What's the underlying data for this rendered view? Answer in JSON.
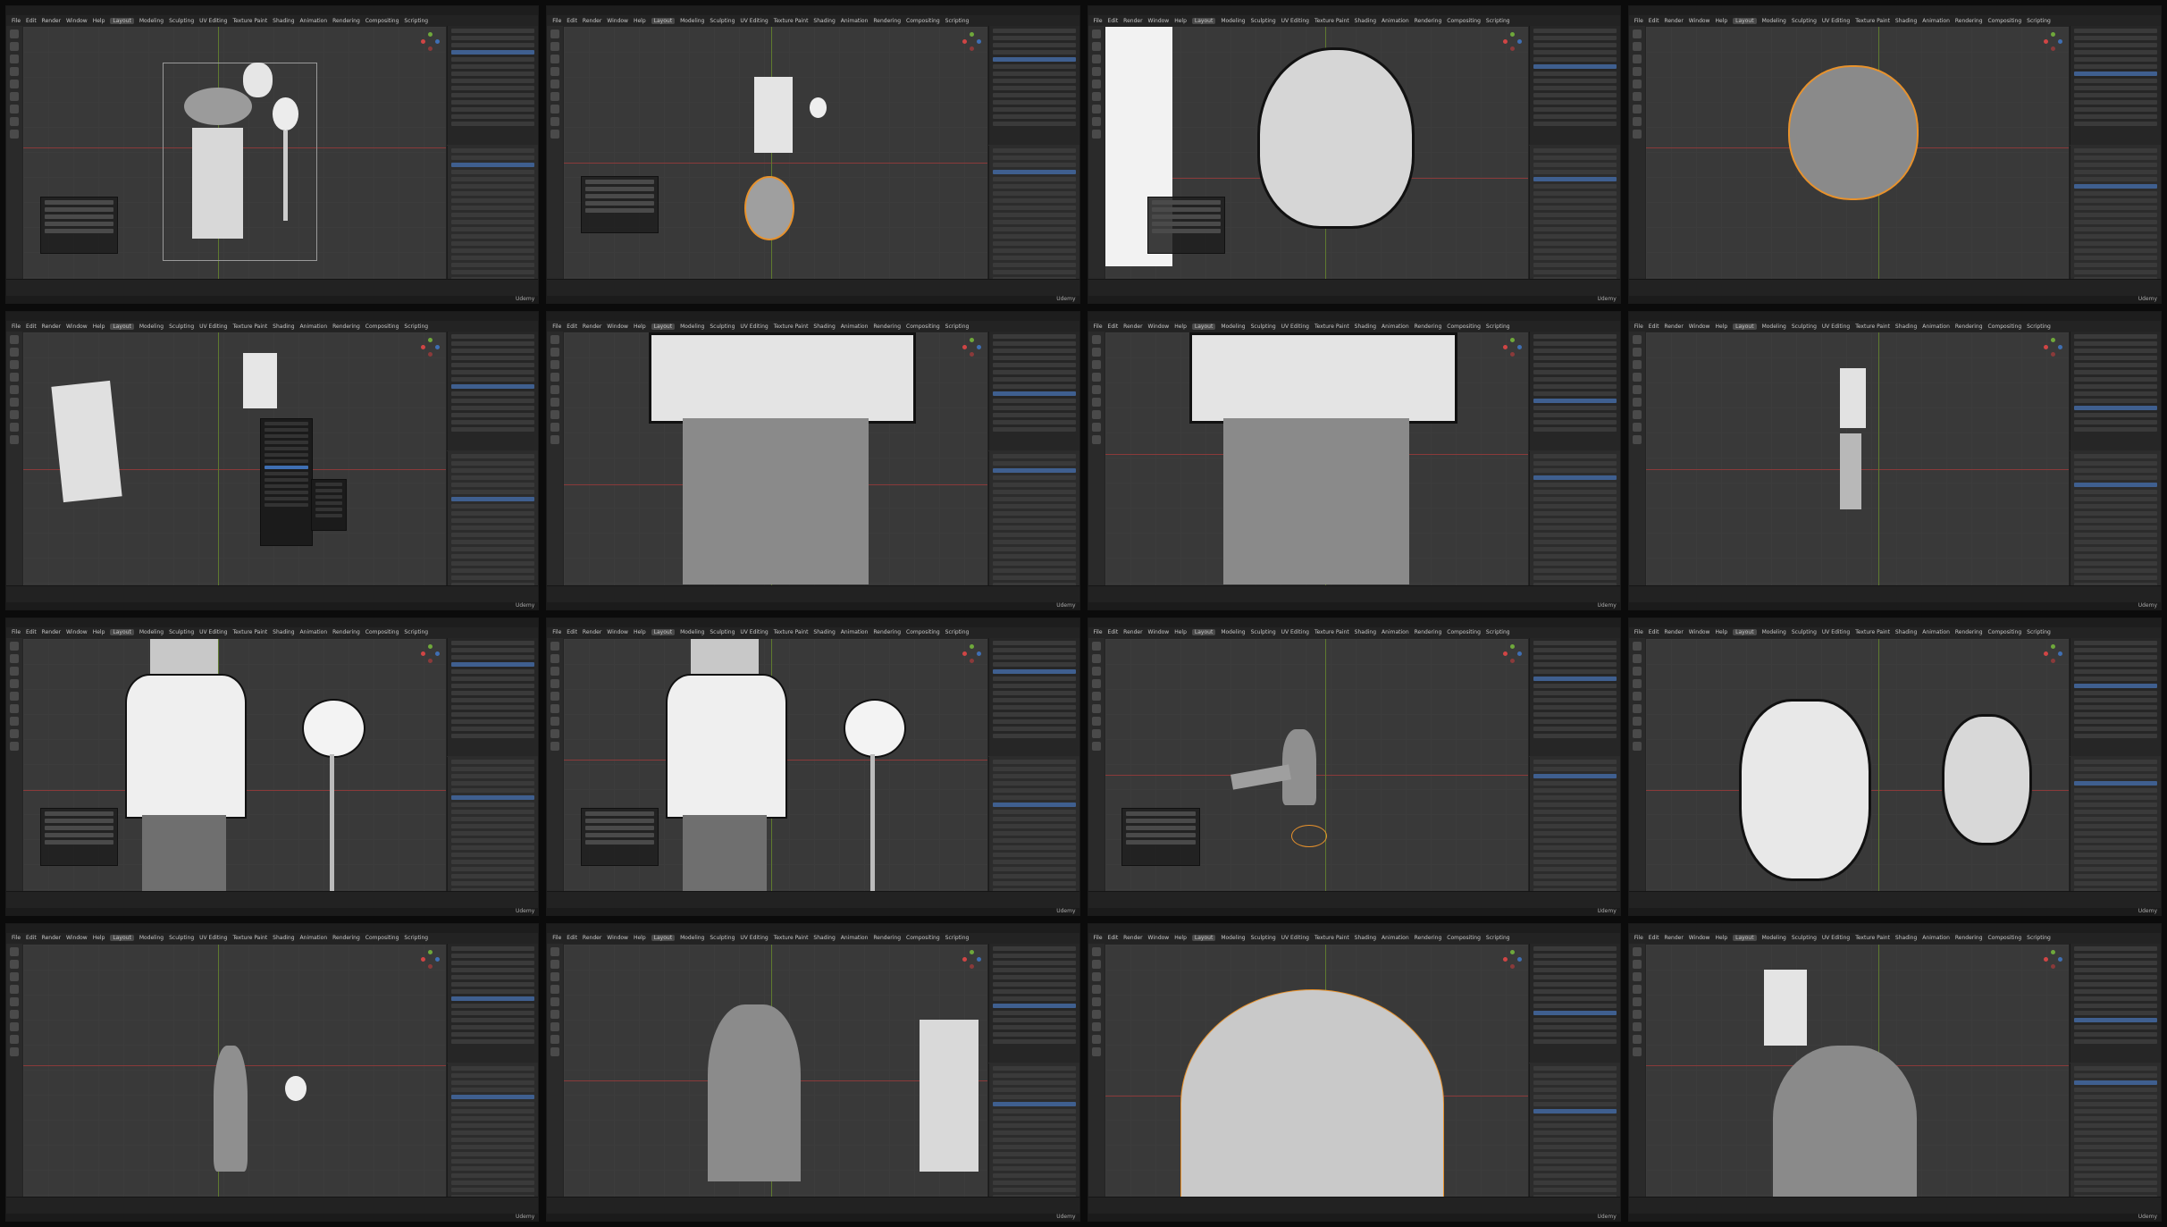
{
  "contact_sheet": {
    "watermark": "Udemy",
    "menus": [
      "File",
      "Edit",
      "Render",
      "Window",
      "Help",
      "Layout",
      "Modeling",
      "Sculpting",
      "UV Editing",
      "Texture Paint",
      "Shading",
      "Animation",
      "Rendering",
      "Compositing",
      "Scripting"
    ],
    "active_menu": "Layout"
  },
  "colors": {
    "window_bg": "#2b2b2b",
    "viewport_bg": "#393939",
    "selection_orange": "#e8922c",
    "active_blue": "#3f6fb3",
    "axis_x": "#8a3a3a",
    "axis_y": "#5f7a2f"
  }
}
